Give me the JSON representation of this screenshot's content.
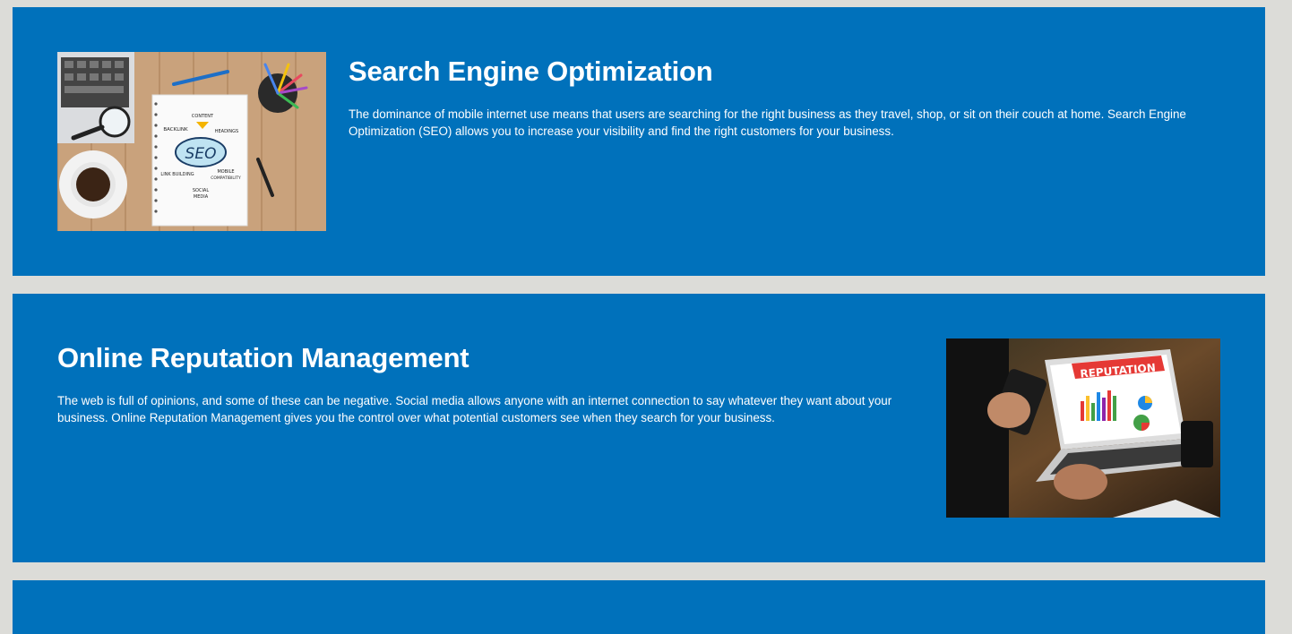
{
  "cards": [
    {
      "title": "Search Engine Optimization",
      "body": "The dominance of mobile internet use means that users are searching for the right business as they travel, shop, or sit on their couch at home. Search Engine Optimization (SEO) allows you to increase your visibility and find the right customers for your business.",
      "image": {
        "labels": [
          "CONTENT",
          "BACKLINK",
          "HEADINGS",
          "SEO",
          "LINK BUILDING",
          "MOBILE",
          "COMPATIBILITY",
          "SOCIAL",
          "MEDIA"
        ]
      }
    },
    {
      "title": "Online Reputation Management",
      "body": "The web is full of opinions, and some of these can be negative. Social media allows anyone with an internet connection to say whatever they want about your business. Online Reputation Management gives you the control over what potential customers see when they search for your business.",
      "image": {
        "labels": [
          "REPUTATION"
        ]
      }
    }
  ],
  "colors": {
    "page_bg": "#dcdcd8",
    "card_bg": "#0071bb",
    "text": "#ffffff"
  }
}
